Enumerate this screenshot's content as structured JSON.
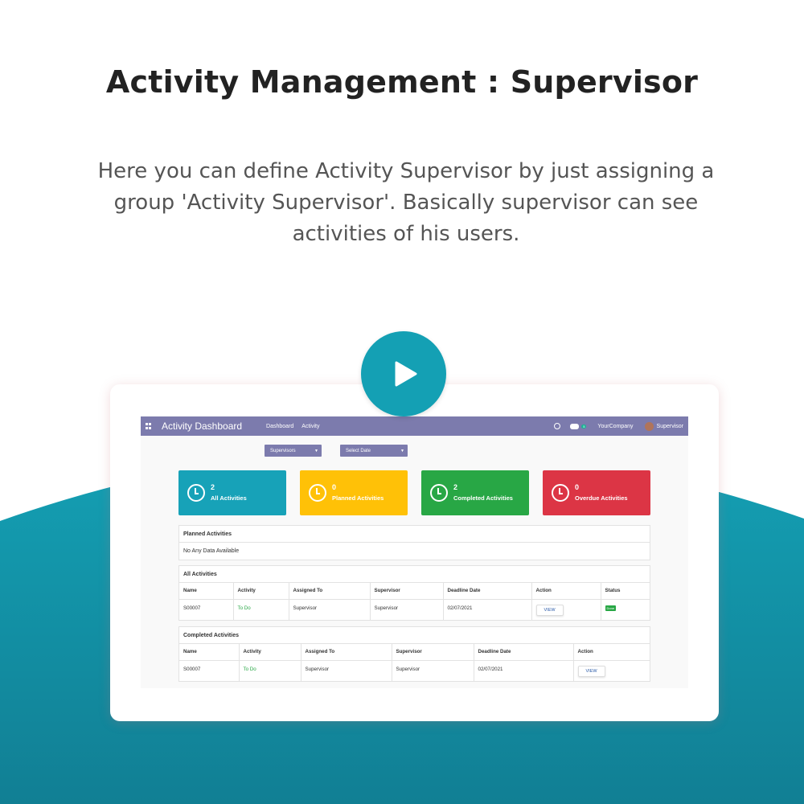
{
  "hero": {
    "title": "Activity Management : Supervisor",
    "description": "Here you can define Activity Supervisor by just assigning a group 'Activity Supervisor'. Basically supervisor can see activities of his users."
  },
  "colors": {
    "teal": "#14a0b4",
    "navbar": "#7c7bad",
    "tile_all": "#17a2b8",
    "tile_planned": "#ffc107",
    "tile_completed": "#28a745",
    "tile_overdue": "#dc3545"
  },
  "navbar": {
    "title": "Activity Dashboard",
    "links": [
      "Dashboard",
      "Activity"
    ],
    "chat_badge": "5",
    "company": "YourCompany",
    "user": "Supervisor"
  },
  "filters": {
    "supervisors": "Supervisors",
    "date": "Select Date"
  },
  "tiles": [
    {
      "count": "2",
      "label": "All Activities",
      "color": "#17a2b8"
    },
    {
      "count": "0",
      "label": "Planned Activities",
      "color": "#ffc107"
    },
    {
      "count": "2",
      "label": "Completed Activities",
      "color": "#28a745"
    },
    {
      "count": "0",
      "label": "Overdue Activities",
      "color": "#dc3545"
    }
  ],
  "planned": {
    "title": "Planned Activities",
    "empty": "No Any Data Available"
  },
  "all_activities": {
    "title": "All Activities",
    "headers": [
      "Name",
      "Activity",
      "Assigned To",
      "Supervisor",
      "Deadline Date",
      "Action",
      "Status"
    ],
    "row": {
      "name": "S00007",
      "activity": "To Do",
      "assigned_to": "Supervisor",
      "supervisor": "Supervisor",
      "deadline": "02/07/2021",
      "action": "VIEW",
      "status": "Done"
    }
  },
  "completed_activities": {
    "title": "Completed Activities",
    "headers": [
      "Name",
      "Activity",
      "Assigned To",
      "Supervisor",
      "Deadline Date",
      "Action"
    ],
    "row": {
      "name": "S00007",
      "activity": "To Do",
      "assigned_to": "Supervisor",
      "supervisor": "Supervisor",
      "deadline": "02/07/2021",
      "action": "VIEW"
    }
  }
}
